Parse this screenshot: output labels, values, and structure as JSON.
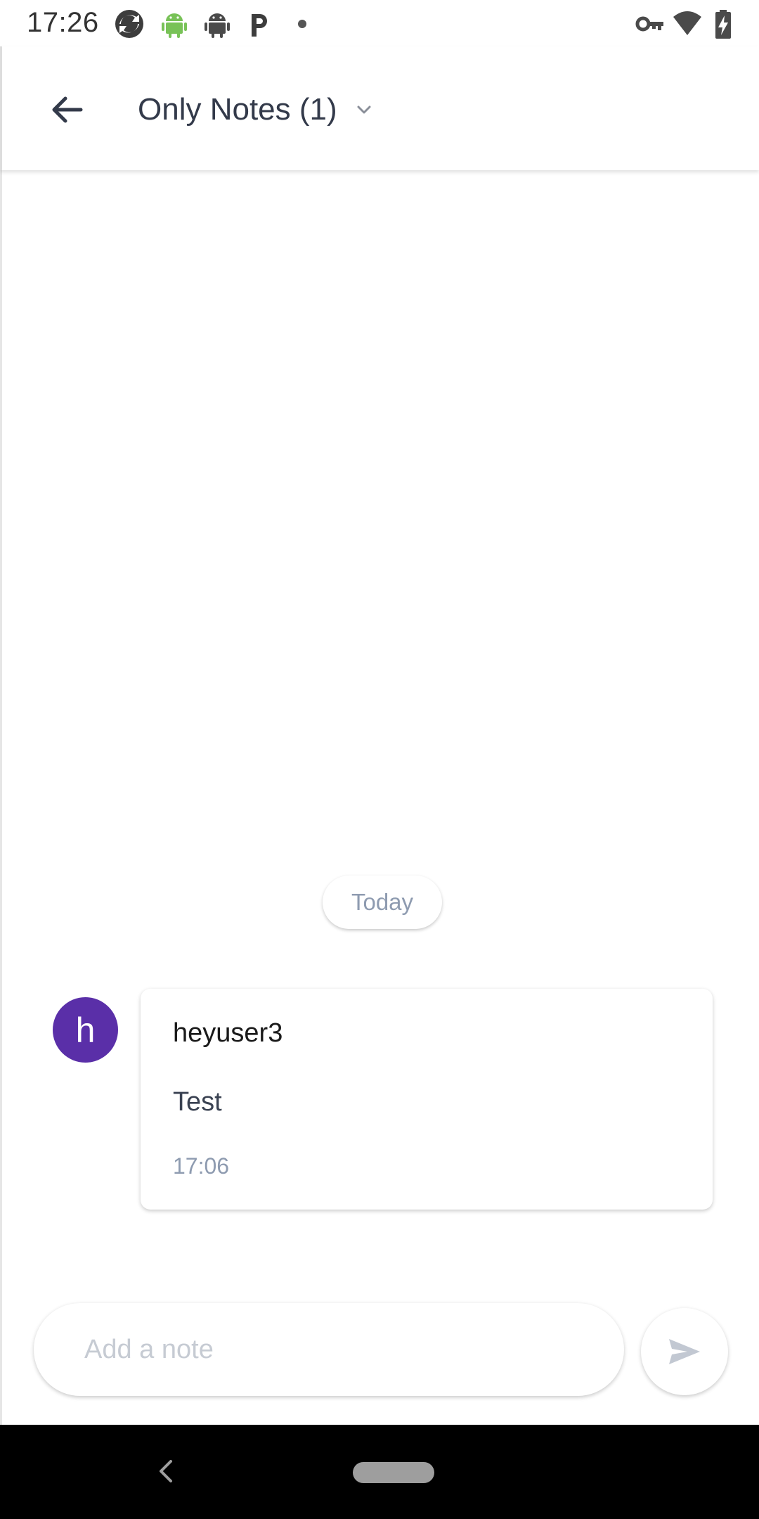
{
  "status_bar": {
    "time": "17:26",
    "left_icons": [
      "sync-icon",
      "android-icon",
      "android-gray-icon",
      "p-app-icon",
      "dot-icon"
    ],
    "right_icons": [
      "vpn-key-icon",
      "wifi-icon",
      "battery-charging-icon"
    ]
  },
  "header": {
    "title": "Only Notes (1)"
  },
  "main": {
    "date_separator": "Today",
    "notes": [
      {
        "avatar_letter": "h",
        "author": "heyuser3",
        "text": "Test",
        "time": "17:06"
      }
    ]
  },
  "composer": {
    "placeholder": "Add a note",
    "value": ""
  },
  "colors": {
    "avatar": "#5a2fa8",
    "android_green": "#78c257",
    "muted_text": "#8e9bb0"
  }
}
